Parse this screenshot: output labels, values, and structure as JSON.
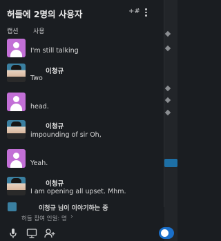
{
  "header": {
    "title": "허들에 2명의 사용자",
    "add_people_label": "+#"
  },
  "tabs": [
    {
      "label": "캡션"
    },
    {
      "label": "사용"
    }
  ],
  "messages": [
    {
      "author": "",
      "avatar": "purple",
      "text": "I'm still talking"
    },
    {
      "author": "이청규",
      "avatar": "photo",
      "text": "Two"
    },
    {
      "author": "",
      "avatar": "purple",
      "text": "head."
    },
    {
      "author": "이청규",
      "avatar": "photo",
      "text": "impounding of sir Oh,"
    },
    {
      "author": "",
      "avatar": "purple",
      "text": "Yeah."
    },
    {
      "author": "이청규",
      "avatar": "photo",
      "text": "I am opening all upset. Mhm."
    }
  ],
  "speaking": {
    "text": "이청규 님이 이야기하는 중"
  },
  "participants": {
    "text": "허들 참여 인원: 명",
    "chevron": "›"
  },
  "bottom": {
    "icons": [
      "microphone-icon",
      "screen-share-icon",
      "add-person-icon",
      "headphones-icon"
    ]
  },
  "colors": {
    "accent": "#1a6fc9",
    "background": "#1a1d21",
    "avatar_purple": "#c26fd6"
  }
}
